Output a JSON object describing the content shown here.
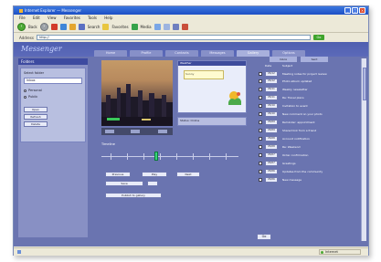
{
  "window": {
    "title": "Internet Explorer — Messenger"
  },
  "menu": [
    "File",
    "Edit",
    "View",
    "Favorites",
    "Tools",
    "Help"
  ],
  "toolbar": {
    "back_label": "Back",
    "search_label": "Search",
    "favorites_label": "Favorites",
    "media_label": "Media"
  },
  "address": {
    "label": "Address",
    "value": "http://",
    "go_label": "Go"
  },
  "app": {
    "logo": "Messenger"
  },
  "tabs": [
    "Home",
    "Profile",
    "Contacts",
    "Messages",
    "Gallery",
    "Options"
  ],
  "sidebar": {
    "header": "Folders",
    "field_label": "Select folder",
    "select_value": "Inbox",
    "radios": [
      "Personal",
      "Public"
    ],
    "buttons": [
      "Open",
      "Refresh",
      "Delete"
    ]
  },
  "weather": {
    "header": "Weather",
    "note": "Sunny"
  },
  "info_box": "Status: Online",
  "slider": {
    "label": "Timeline"
  },
  "controls": {
    "prev": "Previous",
    "play": "Play",
    "next": "Next",
    "save": "Save",
    "publish": "Publish to gallery"
  },
  "list": {
    "tabs": [
      "Inbox",
      "Sent"
    ],
    "col_date": "Date",
    "col_subject": "Subject",
    "rows": [
      {
        "date": "05/12",
        "title": "Meeting notes for project review"
      },
      {
        "date": "05/12",
        "title": "Photo album updated"
      },
      {
        "date": "05/11",
        "title": "Weekly newsletter"
      },
      {
        "date": "05/11",
        "title": "Re: Travel plans"
      },
      {
        "date": "05/10",
        "title": "Invitation to event"
      },
      {
        "date": "05/10",
        "title": "New comment on your photo"
      },
      {
        "date": "05/09",
        "title": "Reminder: appointment"
      },
      {
        "date": "05/09",
        "title": "Shared link from a friend"
      },
      {
        "date": "05/08",
        "title": "Account notification"
      },
      {
        "date": "05/08",
        "title": "Re: Weekend"
      },
      {
        "date": "05/07",
        "title": "Order confirmation"
      },
      {
        "date": "05/07",
        "title": "Greetings"
      },
      {
        "date": "05/06",
        "title": "Updates from the community"
      },
      {
        "date": "05/06",
        "title": "New message"
      }
    ],
    "go_label": "Go"
  },
  "status": {
    "zone": "Internet"
  }
}
